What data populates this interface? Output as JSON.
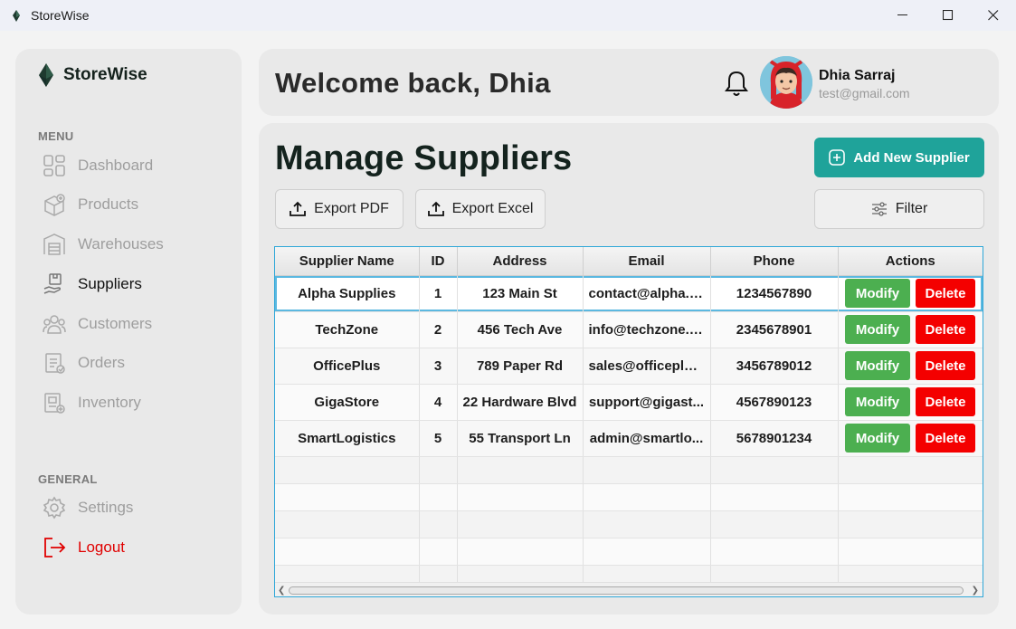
{
  "window": {
    "title": "StoreWise"
  },
  "sidebar": {
    "brand": "StoreWise",
    "menu_label": "MENU",
    "general_label": "GENERAL",
    "items": [
      {
        "label": "Dashboard",
        "icon": "dashboard-icon"
      },
      {
        "label": "Products",
        "icon": "products-icon"
      },
      {
        "label": "Warehouses",
        "icon": "warehouse-icon"
      },
      {
        "label": "Suppliers",
        "icon": "suppliers-icon",
        "active": true
      },
      {
        "label": "Customers",
        "icon": "customers-icon"
      },
      {
        "label": "Orders",
        "icon": "orders-icon"
      },
      {
        "label": "Inventory",
        "icon": "inventory-icon"
      }
    ],
    "general_items": [
      {
        "label": "Settings",
        "icon": "gear-icon"
      },
      {
        "label": "Logout",
        "icon": "logout-icon"
      }
    ]
  },
  "header": {
    "welcome": "Welcome back, Dhia",
    "user_name": "Dhia Sarraj",
    "user_email": "test@gmail.com"
  },
  "main": {
    "title": "Manage Suppliers",
    "add_button": "Add New Supplier",
    "export_pdf": "Export PDF",
    "export_excel": "Export Excel",
    "filter": "Filter"
  },
  "table": {
    "columns": [
      "Supplier Name",
      "ID",
      "Address",
      "Email",
      "Phone",
      "Actions"
    ],
    "rows": [
      {
        "name": "Alpha Supplies",
        "id": "1",
        "address": "123 Main St",
        "email": "contact@alpha.c...",
        "phone": "1234567890"
      },
      {
        "name": "TechZone",
        "id": "2",
        "address": "456 Tech Ave",
        "email": "info@techzone.c...",
        "phone": "2345678901"
      },
      {
        "name": "OfficePlus",
        "id": "3",
        "address": "789 Paper Rd",
        "email": "sales@officeplus...",
        "phone": "3456789012"
      },
      {
        "name": "GigaStore",
        "id": "4",
        "address": "22 Hardware Blvd",
        "email": "support@gigast...",
        "phone": "4567890123"
      },
      {
        "name": "SmartLogistics",
        "id": "5",
        "address": "55 Transport Ln",
        "email": "admin@smartlo...",
        "phone": "5678901234"
      }
    ],
    "modify_label": "Modify",
    "delete_label": "Delete"
  },
  "colors": {
    "accent": "#1fa39a",
    "modify": "#4caf50",
    "delete": "#f40000",
    "logout": "#e00000",
    "selection": "#2ea7d8"
  }
}
